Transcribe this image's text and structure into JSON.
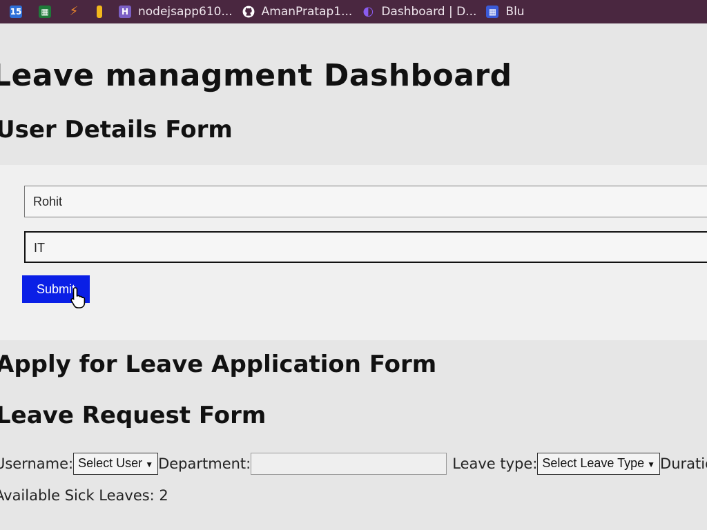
{
  "browser": {
    "bookmarks": [
      {
        "icon": "bookmark-blue-icon",
        "label": ""
      },
      {
        "icon": "bookmark-green-icon",
        "label": ""
      },
      {
        "icon": "bookmark-orange-icon",
        "label": ""
      },
      {
        "icon": "bookmark-yellow-icon",
        "label": ""
      },
      {
        "icon": "heroku-icon",
        "label": "nodejsapp610..."
      },
      {
        "icon": "github-icon",
        "label": "AmanPratap1..."
      },
      {
        "icon": "moon-icon",
        "label": "Dashboard | D..."
      },
      {
        "icon": "grid-icon",
        "label": "Blu"
      }
    ]
  },
  "page": {
    "title": "Leave managment Dashboard",
    "user_form": {
      "heading": "User Details Form",
      "name_value": "Rohit",
      "department_value": "IT",
      "submit_label": "Submit"
    },
    "apply_heading": "Apply for Leave Application Form",
    "leave_form": {
      "heading": "Leave Request Form",
      "username_label": "Username:",
      "username_select": "Select User",
      "department_label": "Department:",
      "department_value": "",
      "leave_type_label": "Leave type:",
      "leave_type_select": "Select Leave Type",
      "duration_label": "Duration:",
      "sick_leaves": "Available Sick Leaves: 2"
    }
  },
  "colors": {
    "bookmark_bar": "#4a2740",
    "submit_button": "#0a1fe6",
    "page_background": "#e6e6e6"
  }
}
